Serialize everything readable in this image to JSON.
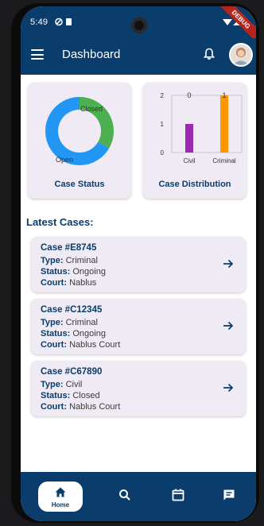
{
  "status_bar": {
    "time": "5:49",
    "debug_banner": "DEBUG"
  },
  "app_bar": {
    "title": "Dashboard",
    "menu_icon": "menu-icon",
    "bell_icon": "bell-icon"
  },
  "cards": {
    "case_status": {
      "title": "Case Status",
      "chart_data": {
        "type": "pie",
        "labels": [
          "Closed",
          "Open"
        ],
        "values": [
          1,
          2
        ],
        "colors": [
          "#4caf50",
          "#2196f3"
        ],
        "donut": true
      }
    },
    "case_distribution": {
      "title": "Case Distribution",
      "chart_data": {
        "type": "bar",
        "categories": [
          "Civil",
          "Criminal"
        ],
        "values": [
          1,
          2
        ],
        "data_labels": [
          "0",
          "1"
        ],
        "colors": [
          "#9c27b0",
          "#ff9800"
        ],
        "yticks": [
          "0",
          "1",
          "2"
        ],
        "ylim": [
          0,
          2
        ]
      }
    }
  },
  "latest_cases": {
    "heading": "Latest Cases:",
    "items": [
      {
        "title": "Case #E8745",
        "type_label": "Type:",
        "type": "Criminal",
        "status_label": "Status:",
        "status": "Ongoing",
        "court_label": "Court:",
        "court": "Nablus"
      },
      {
        "title": "Case #C12345",
        "type_label": "Type:",
        "type": "Criminal",
        "status_label": "Status:",
        "status": "Ongoing",
        "court_label": "Court:",
        "court": "Nablus Court"
      },
      {
        "title": "Case #C67890",
        "type_label": "Type:",
        "type": "Civil",
        "status_label": "Status:",
        "status": "Closed",
        "court_label": "Court:",
        "court": "Nablus Court"
      }
    ]
  },
  "bottom_nav": {
    "home_label": "Home",
    "icons": [
      "home-icon",
      "search-icon",
      "calendar-icon",
      "message-icon"
    ]
  },
  "colors": {
    "primary": "#0a3d6b",
    "card": "#efeaf3"
  }
}
